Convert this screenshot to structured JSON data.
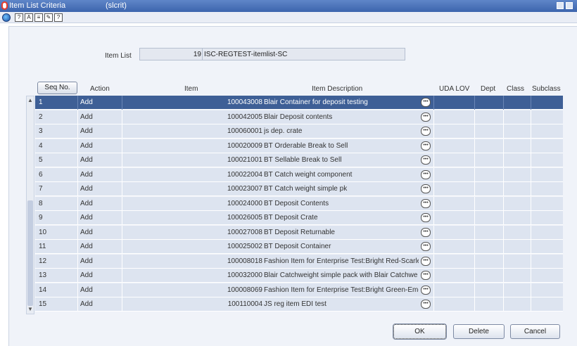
{
  "window": {
    "title": "Item List Criteria",
    "subtitle": "(slcrit)"
  },
  "toolbar": {
    "icons": [
      "globe-icon",
      "help-icon",
      "spell-check-icon",
      "list-icon",
      "edit-icon",
      "question-icon"
    ]
  },
  "item_list": {
    "label": "Item List",
    "number": "19",
    "description": "ISC-REGTEST-itemlist-SC"
  },
  "columns": {
    "seq": "Seq No.",
    "action": "Action",
    "item": "Item",
    "desc": "Item Description",
    "uda": "UDA LOV",
    "dept": "Dept",
    "class": "Class",
    "subclass": "Subclass"
  },
  "rows": [
    {
      "seq": "1",
      "action": "Add",
      "item": "100043008",
      "desc": "Blair Container for deposit testing"
    },
    {
      "seq": "2",
      "action": "Add",
      "item": "100042005",
      "desc": "Blair Deposit contents"
    },
    {
      "seq": "3",
      "action": "Add",
      "item": "100060001",
      "desc": "js dep. crate"
    },
    {
      "seq": "4",
      "action": "Add",
      "item": "100020009",
      "desc": "BT Orderable Break to Sell"
    },
    {
      "seq": "5",
      "action": "Add",
      "item": "100021001",
      "desc": "BT Sellable Break to Sell"
    },
    {
      "seq": "6",
      "action": "Add",
      "item": "100022004",
      "desc": "BT Catch weight component"
    },
    {
      "seq": "7",
      "action": "Add",
      "item": "100023007",
      "desc": "BT Catch weight simple pk"
    },
    {
      "seq": "8",
      "action": "Add",
      "item": "100024000",
      "desc": "BT Deposit Contents"
    },
    {
      "seq": "9",
      "action": "Add",
      "item": "100026005",
      "desc": "BT Deposit Crate"
    },
    {
      "seq": "10",
      "action": "Add",
      "item": "100027008",
      "desc": "BT Deposit Returnable"
    },
    {
      "seq": "11",
      "action": "Add",
      "item": "100025002",
      "desc": "BT Deposit Container"
    },
    {
      "seq": "12",
      "action": "Add",
      "item": "100008018",
      "desc": "Fashion Item for Enterprise Test:Bright Red-Scarle"
    },
    {
      "seq": "13",
      "action": "Add",
      "item": "100032000",
      "desc": "Blair Catchweight simple pack with Blair Catchwe"
    },
    {
      "seq": "14",
      "action": "Add",
      "item": "100008069",
      "desc": "Fashion Item for Enterprise Test:Bright Green-Eme"
    },
    {
      "seq": "15",
      "action": "Add",
      "item": "100110004",
      "desc": "JS reg item EDI test"
    }
  ],
  "buttons": {
    "ok": "OK",
    "delete": "Delete",
    "cancel": "Cancel"
  },
  "colors": {
    "titlebar": "#3c64ad",
    "selected_row": "#3e5f96",
    "row": "#dde4f0",
    "logo": "#e63a2a"
  }
}
